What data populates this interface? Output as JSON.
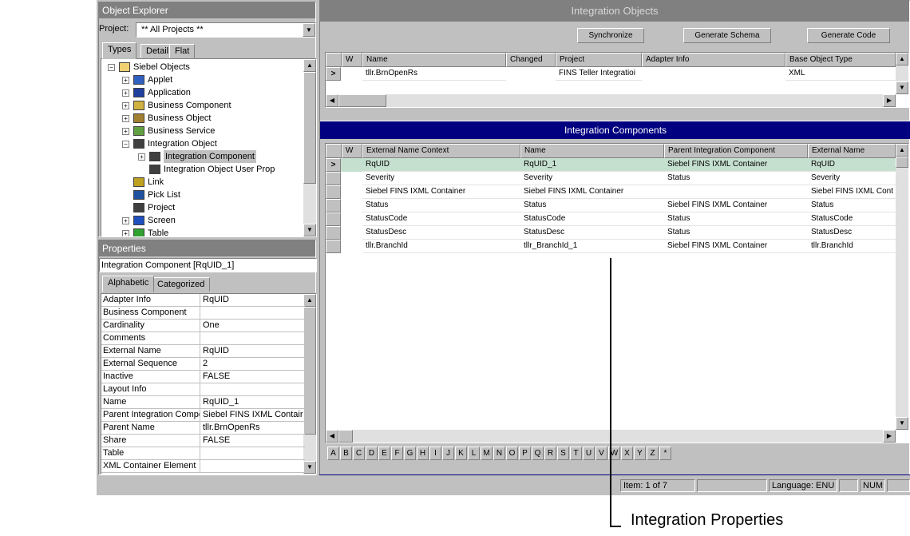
{
  "object_explorer": {
    "title": "Object Explorer",
    "project_label": "Project:",
    "project_value": "** All Projects **",
    "tabs": [
      "Types",
      "Detail",
      "Flat"
    ],
    "tree": [
      {
        "label": "Siebel Objects",
        "icon": "folder-icon",
        "expander": "−"
      },
      {
        "label": "Applet",
        "icon": "applet-icon",
        "expander": "+"
      },
      {
        "label": "Application",
        "icon": "application-icon",
        "expander": "+"
      },
      {
        "label": "Business Component",
        "icon": "business-component-icon",
        "expander": "+"
      },
      {
        "label": "Business Object",
        "icon": "business-object-icon",
        "expander": "+"
      },
      {
        "label": "Business Service",
        "icon": "business-service-icon",
        "expander": "+"
      },
      {
        "label": "Integration Object",
        "icon": "integration-object-icon",
        "expander": "−"
      },
      {
        "label": "Integration Component",
        "icon": "integration-component-icon",
        "expander": "+"
      },
      {
        "label": "Integration Object User Prop",
        "icon": "integration-user-prop-icon",
        "expander": ""
      },
      {
        "label": "Link",
        "icon": "link-icon",
        "expander": ""
      },
      {
        "label": "Pick List",
        "icon": "pick-list-icon",
        "expander": ""
      },
      {
        "label": "Project",
        "icon": "project-icon",
        "expander": ""
      },
      {
        "label": "Screen",
        "icon": "screen-icon",
        "expander": "+"
      },
      {
        "label": "Table",
        "icon": "table-icon",
        "expander": "+"
      }
    ]
  },
  "properties": {
    "title": "Properties",
    "caption": "Integration Component [RqUID_1]",
    "tabs": [
      "Alphabetic",
      "Categorized"
    ],
    "rows": [
      {
        "name": "Adapter Info",
        "value": "RqUID"
      },
      {
        "name": "Business Component",
        "value": ""
      },
      {
        "name": "Cardinality",
        "value": "One"
      },
      {
        "name": "Comments",
        "value": ""
      },
      {
        "name": "External Name",
        "value": "RqUID"
      },
      {
        "name": "External Sequence",
        "value": "2"
      },
      {
        "name": "Inactive",
        "value": "FALSE"
      },
      {
        "name": "Layout Info",
        "value": ""
      },
      {
        "name": "Name",
        "value": "RqUID_1"
      },
      {
        "name": "Parent Integration Compor",
        "value": "Siebel FINS IXML Contair"
      },
      {
        "name": "Parent Name",
        "value": "tllr.BrnOpenRs"
      },
      {
        "name": "Share",
        "value": "FALSE"
      },
      {
        "name": "Table",
        "value": ""
      },
      {
        "name": "XML Container Element",
        "value": ""
      }
    ]
  },
  "integration_objects": {
    "title": "Integration Objects",
    "buttons": {
      "synchronize": "Synchronize",
      "generate_schema": "Generate Schema",
      "generate_code": "Generate Code"
    },
    "columns": [
      "W",
      "Name",
      "Changed",
      "Project",
      "Adapter Info",
      "Base Object Type"
    ],
    "rows": [
      {
        "w": "",
        "name": "tllr.BrnOpenRs",
        "changed": "",
        "project": "FINS Teller Integratioi",
        "adapter": "",
        "base": "XML"
      }
    ]
  },
  "integration_components": {
    "title": "Integration Components",
    "columns": [
      "W",
      "External Name Context",
      "Name",
      "Parent Integration Component",
      "External Name"
    ],
    "rows": [
      {
        "ctx": "RqUID",
        "name": "RqUID_1",
        "parent": "Siebel FINS IXML Container",
        "ext": "RqUID"
      },
      {
        "ctx": "Severity",
        "name": "Severity",
        "parent": "Status",
        "ext": "Severity"
      },
      {
        "ctx": "Siebel FINS IXML Container",
        "name": "Siebel FINS IXML Container",
        "parent": "",
        "ext": "Siebel FINS IXML Cont"
      },
      {
        "ctx": "Status",
        "name": "Status",
        "parent": "Siebel FINS IXML Container",
        "ext": "Status"
      },
      {
        "ctx": "StatusCode",
        "name": "StatusCode",
        "parent": "Status",
        "ext": "StatusCode"
      },
      {
        "ctx": "StatusDesc",
        "name": "StatusDesc",
        "parent": "Status",
        "ext": "StatusDesc"
      },
      {
        "ctx": "tllr.BranchId",
        "name": "tllr_BranchId_1",
        "parent": "Siebel FINS IXML Container",
        "ext": "tllr.BranchId"
      }
    ],
    "alphabet": [
      "A",
      "B",
      "C",
      "D",
      "E",
      "F",
      "G",
      "H",
      "I",
      "J",
      "K",
      "L",
      "M",
      "N",
      "O",
      "P",
      "Q",
      "R",
      "S",
      "T",
      "U",
      "V",
      "W",
      "X",
      "Y",
      "Z",
      "*"
    ]
  },
  "status_bar": {
    "item": "Item:  1 of 7",
    "language": "Language: ENU",
    "num": "NUM"
  },
  "callout": "Integration Properties",
  "colors": {
    "selected_row": "#c6e0cf",
    "header_navy": "#000080",
    "panel_gray": "#c0c0c0"
  }
}
